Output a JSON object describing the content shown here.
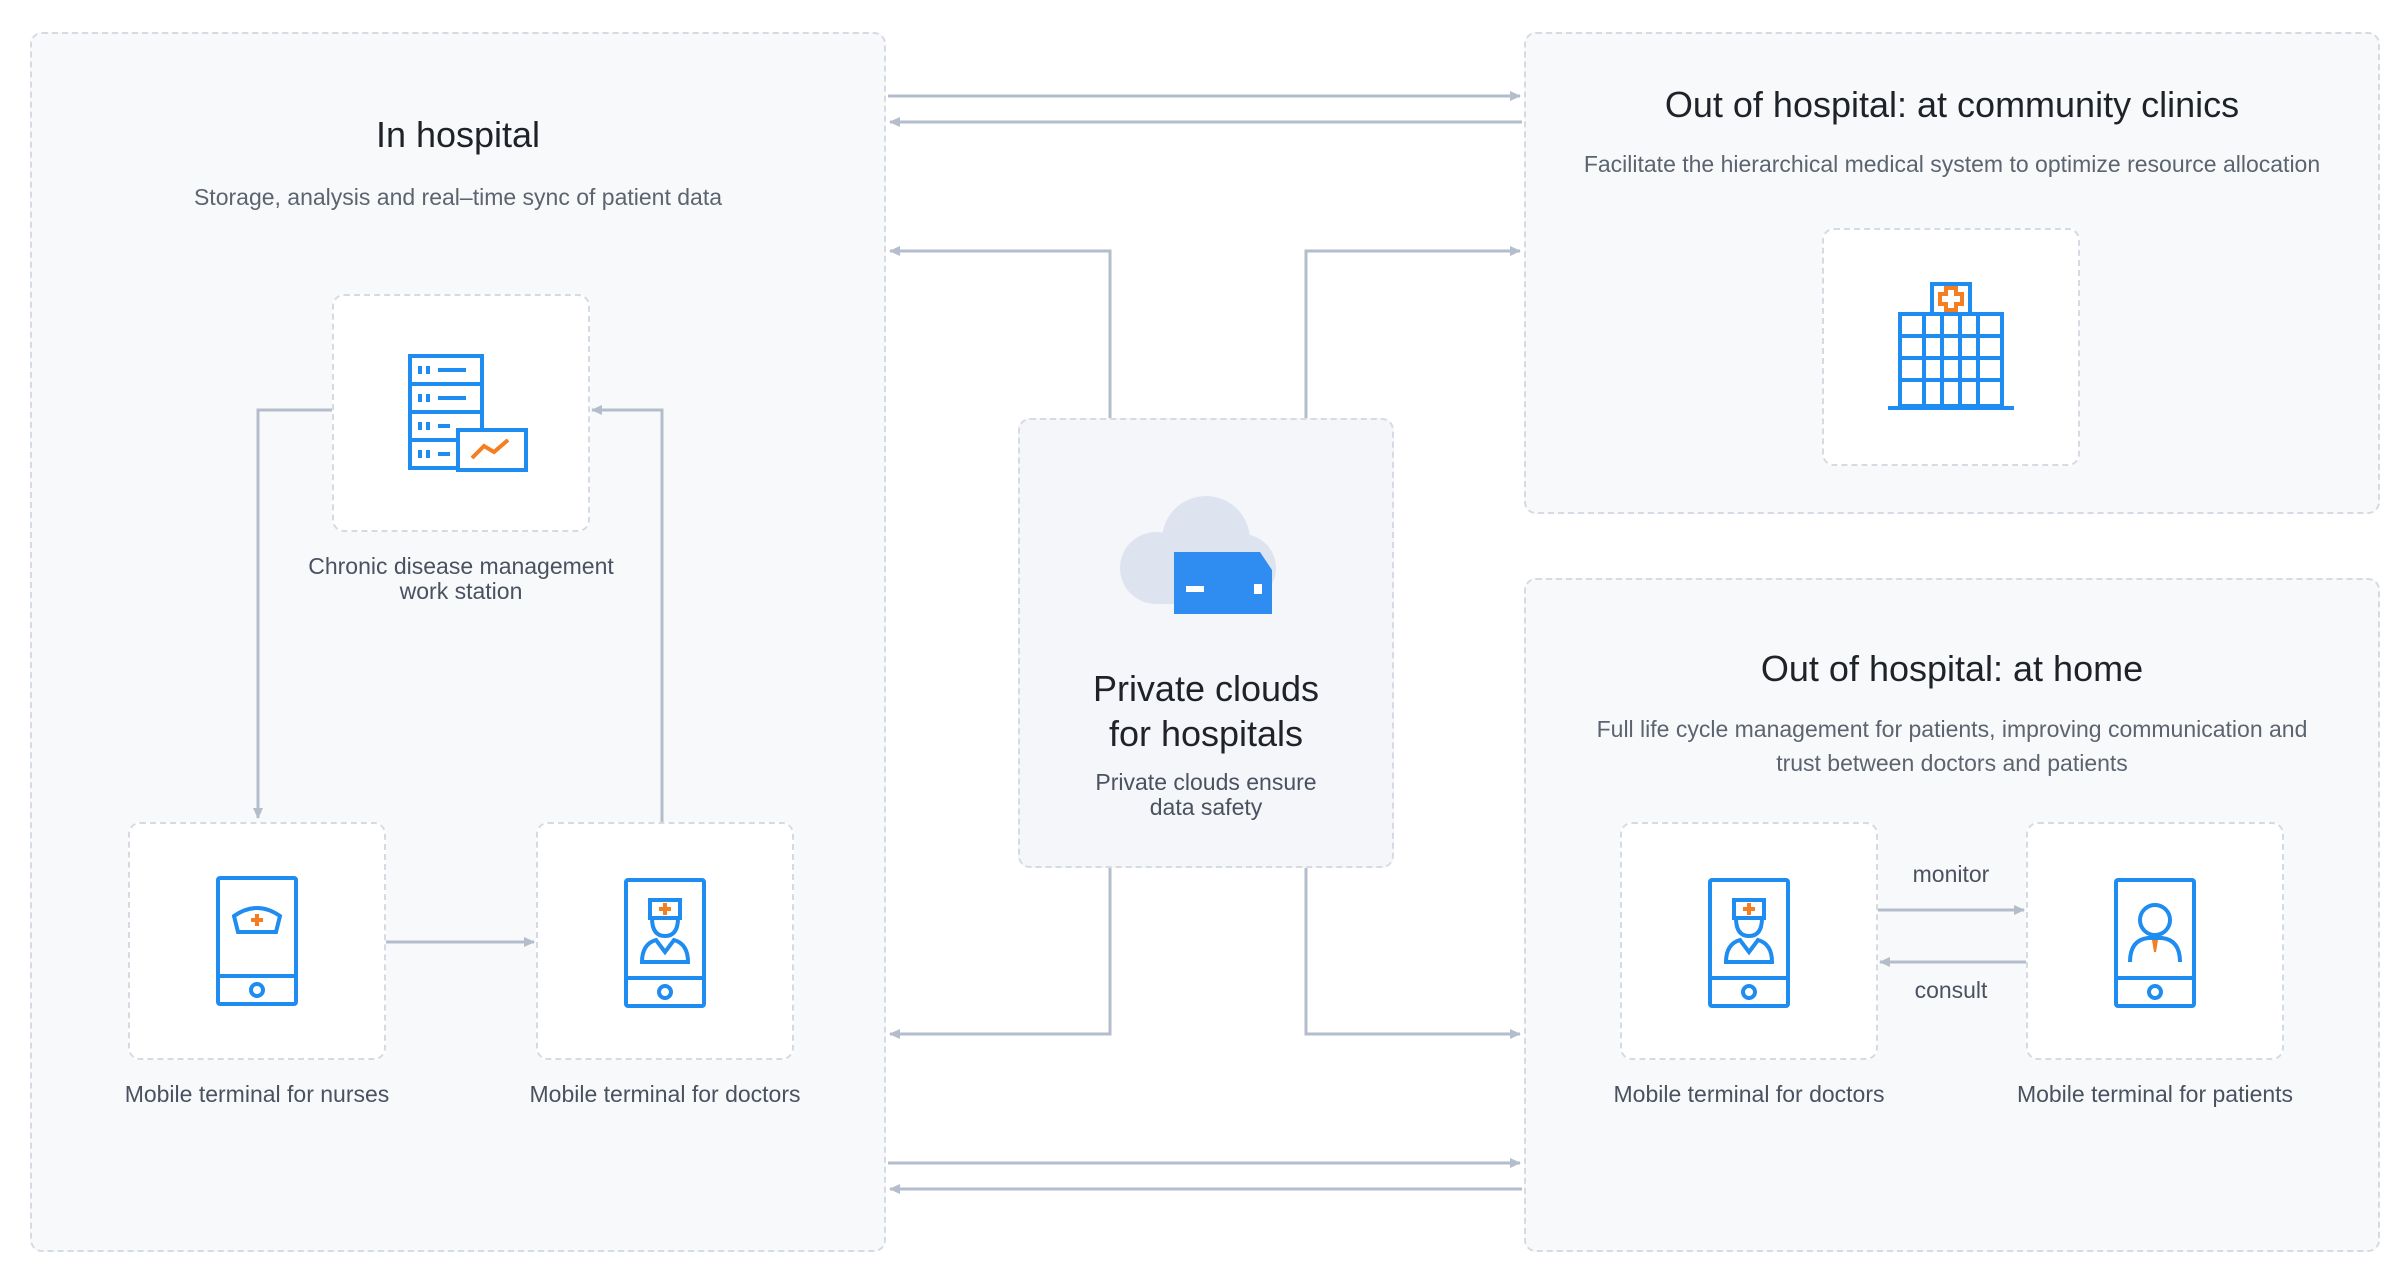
{
  "in_hospital": {
    "title": "In hospital",
    "subtitle": "Storage, analysis and real–time sync of patient data",
    "workstation_label_1": "Chronic disease management",
    "workstation_label_2": "work station",
    "nurses_label": "Mobile terminal for nurses",
    "doctors_label": "Mobile terminal for doctors"
  },
  "private_cloud": {
    "title_1": "Private clouds",
    "title_2": "for hospitals",
    "subtitle_1": "Private clouds ensure",
    "subtitle_2": "data safety"
  },
  "community": {
    "title": "Out of hospital: at community clinics",
    "subtitle": "Facilitate the hierarchical medical system to optimize resource allocation"
  },
  "home": {
    "title": "Out of hospital: at home",
    "subtitle_1": "Full life cycle management for patients, improving communication and",
    "subtitle_2": "trust between doctors and patients",
    "monitor_label": "monitor",
    "consult_label": "consult",
    "doctors_label": "Mobile terminal for doctors",
    "patients_label": "Mobile terminal for patients"
  },
  "colors": {
    "icon_blue": "#1e8cf0",
    "accent_orange": "#f47e20",
    "arrow_gray": "#b3bdcc",
    "cloud_light": "#dde4f0",
    "server_blue": "#2f8cf0"
  }
}
